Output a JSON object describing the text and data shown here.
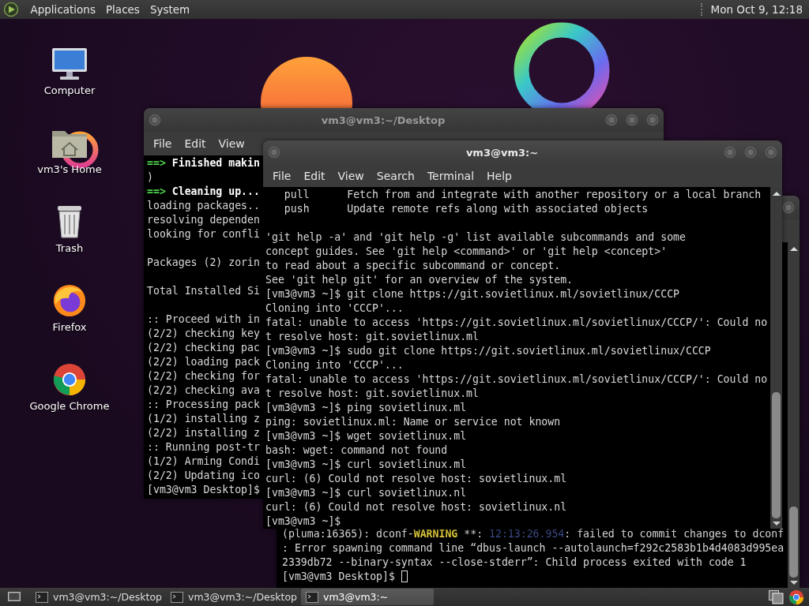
{
  "top_panel": {
    "menus": [
      "Applications",
      "Places",
      "System"
    ],
    "clock": "Mon Oct 9, 12:18"
  },
  "desktop_icons": [
    {
      "label": "Computer",
      "kind": "computer"
    },
    {
      "label": "vm3's Home",
      "kind": "home"
    },
    {
      "label": "Trash",
      "kind": "trash"
    },
    {
      "label": "Firefox",
      "kind": "firefox"
    },
    {
      "label": "Google Chrome",
      "kind": "chrome"
    }
  ],
  "windows": [
    {
      "kind": "front",
      "title": "vm3@vm3:~",
      "menus": [
        "File",
        "Edit",
        "View",
        "Search",
        "Terminal",
        "Help"
      ],
      "lines": [
        "   pull      Fetch from and integrate with another repository or a local branch",
        "   push      Update remote refs along with associated objects",
        {
          "kind": "blank"
        },
        "'git help -a' and 'git help -g' list available subcommands and some",
        "concept guides. See 'git help <command>' or 'git help <concept>'",
        "to read about a specific subcommand or concept.",
        "See 'git help git' for an overview of the system.",
        "[vm3@vm3 ~]$ git clone https://git.sovietlinux.ml/sovietlinux/CCCP",
        "Cloning into 'CCCP'...",
        "fatal: unable to access 'https://git.sovietlinux.ml/sovietlinux/CCCP/': Could no",
        "t resolve host: git.sovietlinux.ml",
        "[vm3@vm3 ~]$ sudo git clone https://git.sovietlinux.ml/sovietlinux/CCCP",
        "Cloning into 'CCCP'...",
        "fatal: unable to access 'https://git.sovietlinux.ml/sovietlinux/CCCP/': Could no",
        "t resolve host: git.sovietlinux.ml",
        "[vm3@vm3 ~]$ ping sovietlinux.ml",
        "ping: sovietlinux.ml: Name or service not known",
        "[vm3@vm3 ~]$ wget sovietlinux.ml",
        "bash: wget: command not found",
        "[vm3@vm3 ~]$ curl sovietlinux.ml",
        "curl: (6) Could not resolve host: sovietlinux.ml",
        "[vm3@vm3 ~]$ curl sovietlinux.nl",
        "curl: (6) Could not resolve host: sovietlinux.nl",
        "[vm3@vm3 ~]$"
      ]
    },
    {
      "kind": "under",
      "cursor": true,
      "lines": [
        {
          "parts": [
            {
              "kind": "plain",
              "text": "(pluma:16365): dconf-"
            },
            {
              "kind": "warning",
              "text": "WARNING"
            },
            {
              "kind": "plain",
              "text": " **: "
            },
            {
              "kind": "time",
              "text": "12:13:26.954"
            },
            {
              "kind": "plain",
              "text": ": failed to commit changes to dconf"
            }
          ]
        },
        ": Error spawning command line “dbus-launch --autolaunch=f292c2583b1b4d4083d995ea",
        "2339db72 --binary-syntax --close-stderr”: Child process exited with code 1",
        "[vm3@vm3 Desktop]$ "
      ]
    },
    {
      "kind": "back",
      "title": "vm3@vm3:~/Desktop",
      "menus": [
        "File",
        "Edit",
        "View"
      ],
      "lines": [
        {
          "parts": [
            {
              "kind": "arrow",
              "text": "==>"
            },
            {
              "kind": "bold",
              "text": " Finished makin"
            }
          ]
        },
        ")",
        {
          "parts": [
            {
              "kind": "arrow",
              "text": "==>"
            },
            {
              "kind": "bold",
              "text": " Cleaning up..."
            }
          ]
        },
        "loading packages..",
        "resolving dependen",
        "looking for confli",
        {
          "kind": "blank"
        },
        "Packages (2) zorin",
        {
          "kind": "blank"
        },
        "Total Installed Si",
        {
          "kind": "blank"
        },
        ":: Proceed with in",
        "(2/2) checking key",
        "(2/2) checking pac",
        "(2/2) loading pack",
        "(2/2) checking for",
        "(2/2) checking ava",
        ":: Processing pack",
        "(1/2) installing z",
        "(2/2) installing z",
        ":: Running post-tr",
        "(1/2) Arming Condi",
        "(2/2) Updating ico",
        "[vm3@vm3 Desktop]$"
      ]
    }
  ],
  "taskbar": {
    "tasks": [
      {
        "label": "vm3@vm3:~/Desktop",
        "selected": false
      },
      {
        "label": "vm3@vm3:~/Desktop",
        "selected": false
      },
      {
        "label": "vm3@vm3:~",
        "selected": true
      }
    ]
  }
}
